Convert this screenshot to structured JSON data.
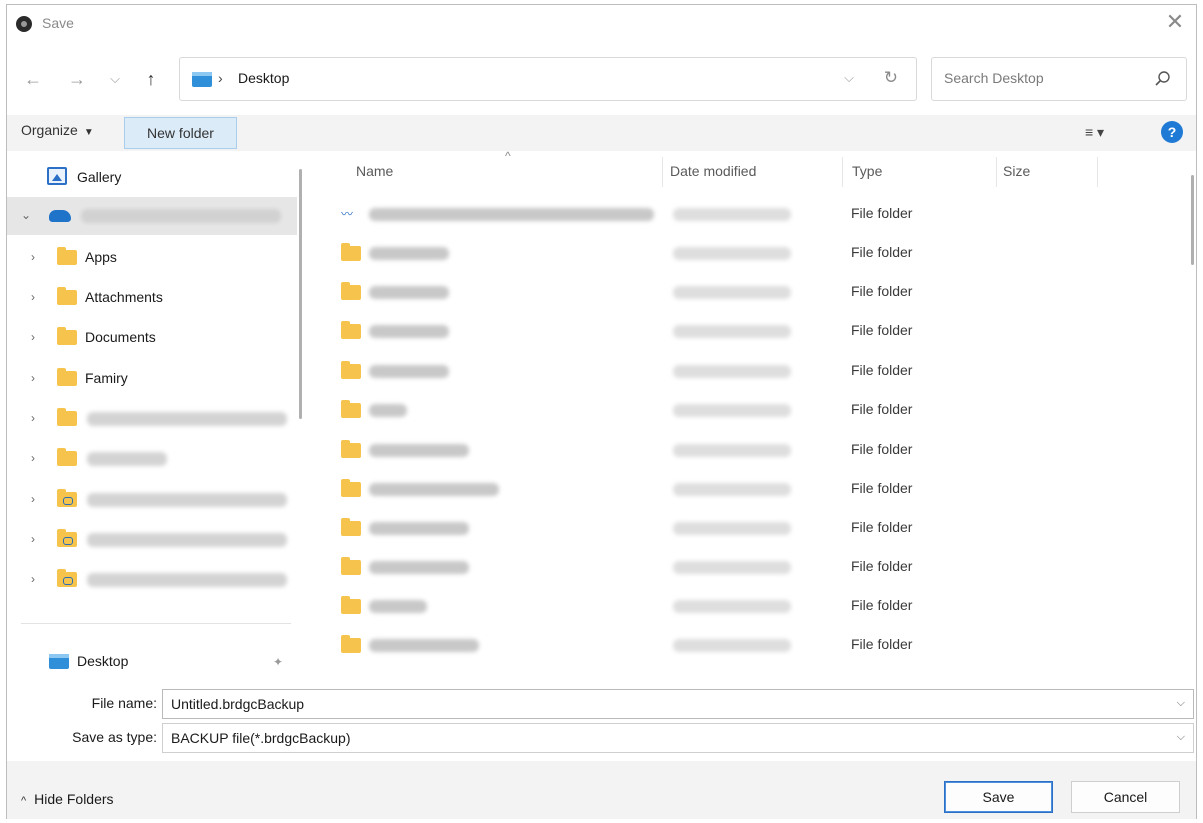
{
  "window": {
    "title": "Save",
    "close_symbol": "✕"
  },
  "nav": {
    "back": "←",
    "forward": "→",
    "recent": "⌵",
    "up": "↑",
    "breadcrumb_sep": "›",
    "location": "Desktop",
    "address_dropdown": "⌵",
    "refresh": "↻",
    "search_placeholder": "Search Desktop"
  },
  "toolbar": {
    "organize_label": "Organize",
    "organize_caret": "▼",
    "new_folder_label": "New folder",
    "view_menu": "≡ ▾",
    "help_label": "?"
  },
  "sidebar": {
    "gallery_label": "Gallery",
    "onedrive_label": "",
    "items": [
      {
        "label": "Apps",
        "chevron": "›"
      },
      {
        "label": "Attachments",
        "chevron": "›"
      },
      {
        "label": "Documents",
        "chevron": "›"
      },
      {
        "label": "Famiry",
        "chevron": "›"
      }
    ],
    "collapse_chevron": "⌄",
    "expand_chevron": "›",
    "desktop_label": "Desktop",
    "pin_symbol": "📌"
  },
  "filelist": {
    "columns": {
      "name": "Name",
      "date": "Date modified",
      "type": "Type",
      "size": "Size"
    },
    "sort_arrow": "^",
    "rows": [
      {
        "type": "File folder"
      },
      {
        "type": "File folder"
      },
      {
        "type": "File folder"
      },
      {
        "type": "File folder"
      },
      {
        "type": "File folder"
      },
      {
        "type": "File folder"
      },
      {
        "type": "File folder"
      },
      {
        "type": "File folder"
      },
      {
        "type": "File folder"
      },
      {
        "type": "File folder"
      },
      {
        "type": "File folder"
      },
      {
        "type": "File folder"
      }
    ]
  },
  "form": {
    "file_name_label": "File name:",
    "file_name_value": "Untitled.brdgcBackup",
    "save_as_type_label": "Save as type:",
    "save_as_type_value": "BACKUP file(*.brdgcBackup)",
    "dropdown_caret": "⌵"
  },
  "footer": {
    "hide_folders_label": "Hide Folders",
    "hide_folders_caret": "^",
    "save_label": "Save",
    "cancel_label": "Cancel"
  }
}
